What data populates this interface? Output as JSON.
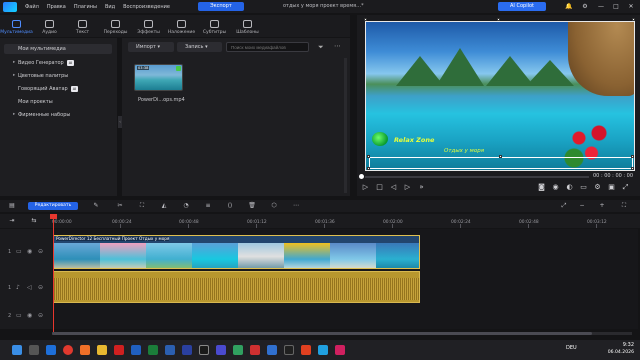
{
  "menubar": {
    "items": [
      "Файл",
      "Правка",
      "Плагины",
      "Вид",
      "Воспроизведение"
    ],
    "export_label": "Экспорт",
    "project_title": "отдых у моря проект время…*",
    "ai_copilot_label": "AI Copilot"
  },
  "tooltabs": [
    {
      "label": "Мультимедиа",
      "icon": "media-icon",
      "active": true
    },
    {
      "label": "Аудио",
      "icon": "music-note-icon",
      "active": false
    },
    {
      "label": "Текст",
      "icon": "text-icon",
      "active": false
    },
    {
      "label": "Переходы",
      "icon": "transition-icon",
      "active": false
    },
    {
      "label": "Эффекты",
      "icon": "effects-icon",
      "active": false
    },
    {
      "label": "Наложение",
      "icon": "overlay-icon",
      "active": false
    },
    {
      "label": "Субтитры",
      "icon": "subtitles-icon",
      "active": false
    },
    {
      "label": "Шаблоны",
      "icon": "templates-icon",
      "active": false
    }
  ],
  "sidebar": {
    "items": [
      {
        "label": "Мои мультимедиа",
        "caret": "",
        "badge": ""
      },
      {
        "label": "Видео Генератор",
        "caret": "▸",
        "badge": "AI"
      },
      {
        "label": "Цветовые палитры",
        "caret": "▸",
        "badge": ""
      },
      {
        "label": "Говорящий Аватар",
        "caret": "",
        "badge": "AI"
      },
      {
        "label": "Мои проекты",
        "caret": "",
        "badge": ""
      },
      {
        "label": "Фирменные наборы",
        "caret": "▸",
        "badge": ""
      }
    ]
  },
  "media": {
    "import_label": "Импорт",
    "record_label": "Запись",
    "search_placeholder": "Поиск моих медиафайлов",
    "thumb_duration": "03:38",
    "thumb_name": "PowerDi...ops.mp4"
  },
  "preview": {
    "overlay_title": "Relax Zone",
    "overlay_subtitle": "Отдых у моря",
    "timecode": "00 : 00 : 00 : 00"
  },
  "timeline": {
    "edit_label": "Редактировать",
    "ruler_labels": [
      "00:00:00",
      "00:00:24",
      "00:00:48",
      "00:01:12",
      "00:01:36",
      "00:02:00",
      "00:02:24",
      "00:02:48",
      "00:03:12"
    ],
    "video_clip_label": "PowerDirector 12 Бесплатный Проект Отдых у моря",
    "track_numbers": [
      "1",
      "1",
      "2"
    ]
  },
  "taskbar": {
    "lang": "DEU",
    "time": "9:32",
    "date": "06.04.2026"
  },
  "colors": {
    "accent": "#2463e6",
    "playhead": "#e8372e",
    "audio_clip": "#b8972e",
    "overlay_text": "#e6ff3a"
  }
}
